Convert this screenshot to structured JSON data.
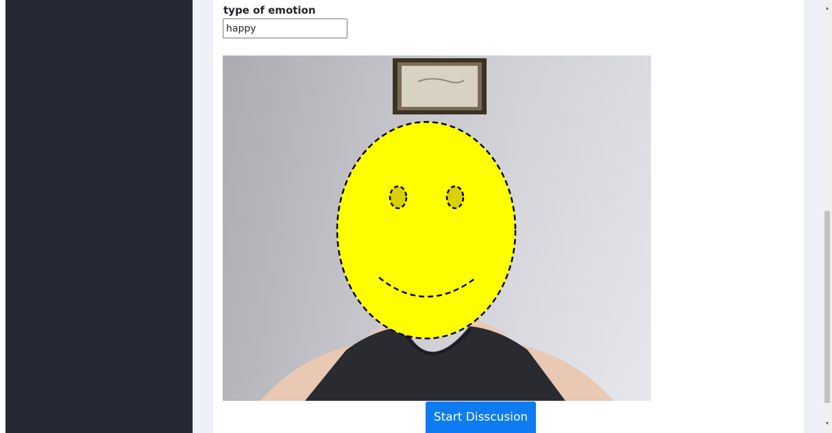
{
  "form": {
    "emotion_label": "type of emotion",
    "emotion_value": "happy"
  },
  "camera": {
    "face_overlay": "smiley-face",
    "overlay_color": "#ffff00",
    "eye_color": "#d8d000"
  },
  "actions": {
    "start_label": "Start Disscusion"
  },
  "colors": {
    "sidebar": "#242933",
    "accent": "#0d7cf2"
  }
}
